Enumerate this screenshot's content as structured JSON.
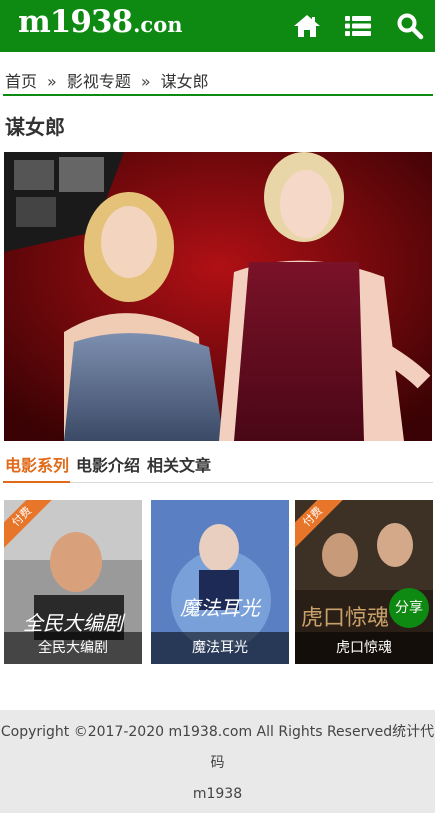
{
  "header": {
    "logo_main": "m1938",
    "logo_suffix": ".con",
    "icons": [
      "home-icon",
      "list-icon",
      "search-icon"
    ],
    "bg_color": "#0e8a12"
  },
  "breadcrumb": {
    "items": [
      "首页",
      "影视专题",
      "谋女郎"
    ],
    "separator": "»"
  },
  "page": {
    "title": "谋女郎"
  },
  "tabs": [
    {
      "label": "电影系列",
      "active": true
    },
    {
      "label": "电影介绍",
      "active": false
    },
    {
      "label": "相关文章",
      "active": false
    }
  ],
  "cards": [
    {
      "title": "全民大编剧",
      "badge": "付费",
      "poster_text": "全民大编剧"
    },
    {
      "title": "魔法耳光",
      "badge": "",
      "poster_text": "魔法耳光"
    },
    {
      "title": "虎口惊魂",
      "badge": "付费",
      "poster_text": "虎口惊魂"
    }
  ],
  "share_label": "分享",
  "footer": {
    "line1": "Copyright ©2017-2020 m1938.com All Rights Reserved统计代",
    "line2": "码",
    "line3": "m1938"
  },
  "colors": {
    "accent_green": "#0e8a12",
    "tab_active": "#e06a1a",
    "badge": "#e8762a"
  }
}
